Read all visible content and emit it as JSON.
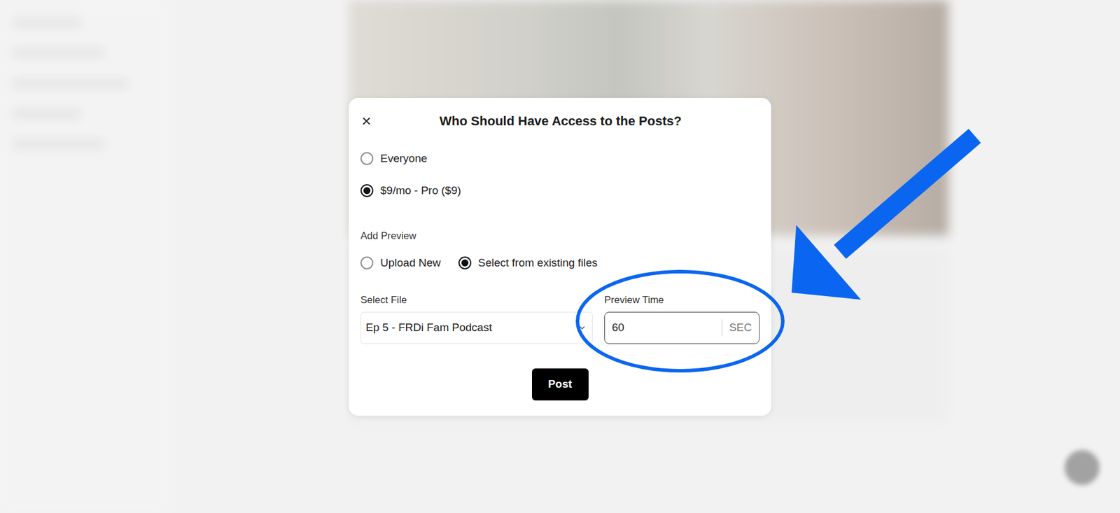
{
  "dialog": {
    "title": "Who Should Have Access to the Posts?",
    "close": "×"
  },
  "access_options": [
    {
      "label": "Everyone",
      "selected": false
    },
    {
      "label": "$9/mo - Pro ($9)",
      "selected": true
    }
  ],
  "preview": {
    "label": "Add Preview",
    "options": [
      {
        "label": "Upload New",
        "selected": false
      },
      {
        "label": "Select from existing files",
        "selected": true
      }
    ],
    "file": {
      "label": "Select File",
      "value": "Ep 5 - FRDi Fam Podcast"
    },
    "time": {
      "label": "Preview Time",
      "value": "60",
      "unit": "SEC"
    }
  },
  "buttons": [
    "Post"
  ]
}
